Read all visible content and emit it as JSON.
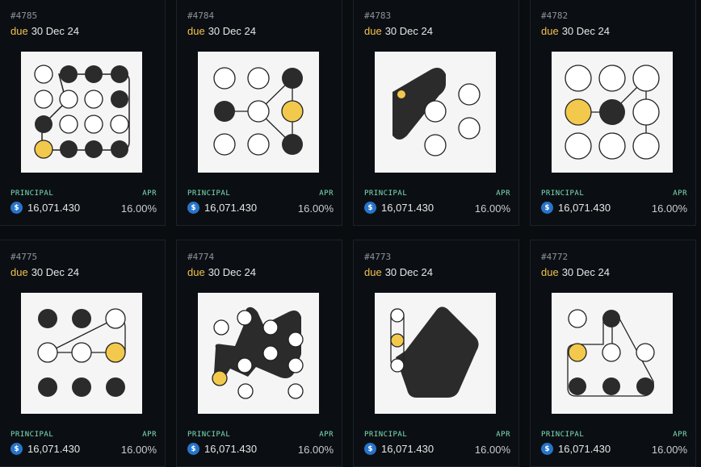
{
  "colors": {
    "accent": "#f2c14e",
    "label": "#7fe0b8",
    "coin": "#2775ca"
  },
  "cards": [
    {
      "id": "#4785",
      "due_word": "due",
      "due_date": "30 Dec 24",
      "principal_label": "PRINCIPAL",
      "apr_label": "APR",
      "amount": "16,071.430",
      "apr": "16.00%",
      "coin_icon": "usdc-icon"
    },
    {
      "id": "#4784",
      "due_word": "due",
      "due_date": "30 Dec 24",
      "principal_label": "PRINCIPAL",
      "apr_label": "APR",
      "amount": "16,071.430",
      "apr": "16.00%",
      "coin_icon": "usdc-icon"
    },
    {
      "id": "#4783",
      "due_word": "due",
      "due_date": "30 Dec 24",
      "principal_label": "PRINCIPAL",
      "apr_label": "APR",
      "amount": "16,071.430",
      "apr": "16.00%",
      "coin_icon": "usdc-icon"
    },
    {
      "id": "#4782",
      "due_word": "due",
      "due_date": "30 Dec 24",
      "principal_label": "PRINCIPAL",
      "apr_label": "APR",
      "amount": "16,071.430",
      "apr": "16.00%",
      "coin_icon": "usdc-icon"
    },
    {
      "id": "#4775",
      "due_word": "due",
      "due_date": "30 Dec 24",
      "principal_label": "PRINCIPAL",
      "apr_label": "APR",
      "amount": "16,071.430",
      "apr": "16.00%",
      "coin_icon": "usdc-icon"
    },
    {
      "id": "#4774",
      "due_word": "due",
      "due_date": "30 Dec 24",
      "principal_label": "PRINCIPAL",
      "apr_label": "APR",
      "amount": "16,071.430",
      "apr": "16.00%",
      "coin_icon": "usdc-icon"
    },
    {
      "id": "#4773",
      "due_word": "due",
      "due_date": "30 Dec 24",
      "principal_label": "PRINCIPAL",
      "apr_label": "APR",
      "amount": "16,071.430",
      "apr": "16.00%",
      "coin_icon": "usdc-icon"
    },
    {
      "id": "#4772",
      "due_word": "due",
      "due_date": "30 Dec 24",
      "principal_label": "PRINCIPAL",
      "apr_label": "APR",
      "amount": "16,071.430",
      "apr": "16.00%",
      "coin_icon": "usdc-icon"
    }
  ]
}
